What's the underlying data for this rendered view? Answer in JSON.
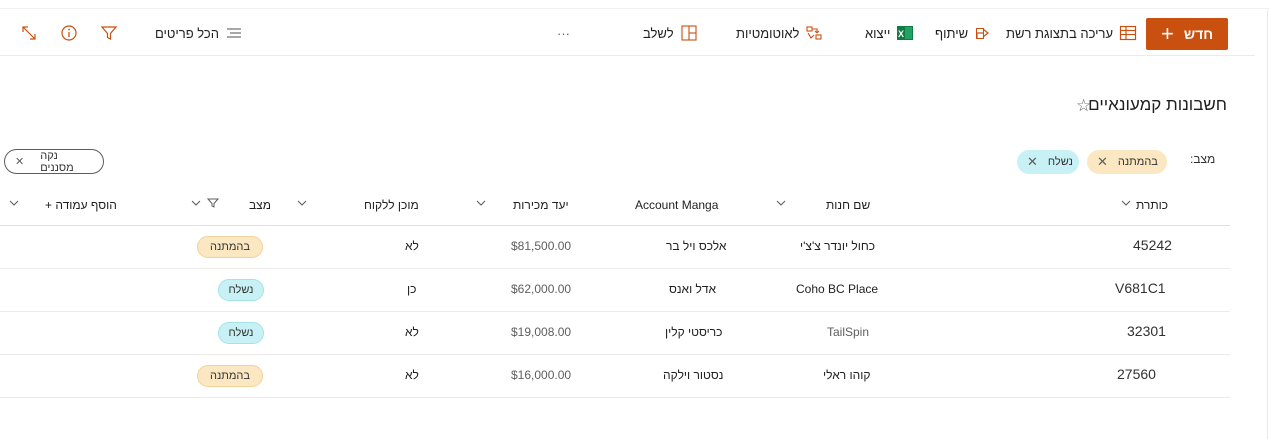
{
  "toolbar": {
    "new_label": "חדש",
    "grid_edit_label": "עריכה בתצוגת רשת",
    "share_label": "שיתוף",
    "export_label": "ייצוא",
    "automate_label": "לאוטומטיות",
    "integrate_label": "לשלב",
    "more_label": "···",
    "all_items_label": "הכל פריטים"
  },
  "page": {
    "title": "חשבונות קמעונאיים",
    "star": "☆"
  },
  "filters": {
    "label": "מצב:",
    "chips": [
      {
        "label": "בהמתנה",
        "close": "✕"
      },
      {
        "label": "נשלח",
        "close": "✕"
      }
    ],
    "clear_label": "נקה מסננים",
    "clear_close": "✕"
  },
  "columns": {
    "title": "כותרת",
    "store": "שם חנות",
    "manager": "Account Manga",
    "sales": "יעד מכירות",
    "ready": "מוכן ללקוח",
    "status": "מצב",
    "add": "+ הוסף עמודה"
  },
  "rows": [
    {
      "title": "45242",
      "store": "כחול יונדר צ'צ'י",
      "manager": "אלכס ויל בר",
      "sales": "$81,500.00",
      "ready": "לא",
      "status": "בהמתנה",
      "status_type": "pending"
    },
    {
      "title": "V681C1",
      "store": "Coho BC Place",
      "manager": "אדל ואנס",
      "sales": "$62,000.00",
      "ready": "כן",
      "status": "נשלח",
      "status_type": "sent"
    },
    {
      "title": "32301",
      "store": "TailSpin",
      "manager": "כריסטי קלין",
      "sales": "$19,008.00",
      "ready": "לא",
      "status": "נשלח",
      "status_type": "sent"
    },
    {
      "title": "27560",
      "store": "קוהו ראלי",
      "manager": "נסטור וילקה",
      "sales": "$16,000.00",
      "ready": "לא",
      "status": "בהמתנה",
      "status_type": "pending"
    }
  ],
  "colors": {
    "accent": "#ca5010",
    "pending": "#fbe8c2",
    "sent": "#c8f1f5",
    "excel": "#107c41"
  }
}
